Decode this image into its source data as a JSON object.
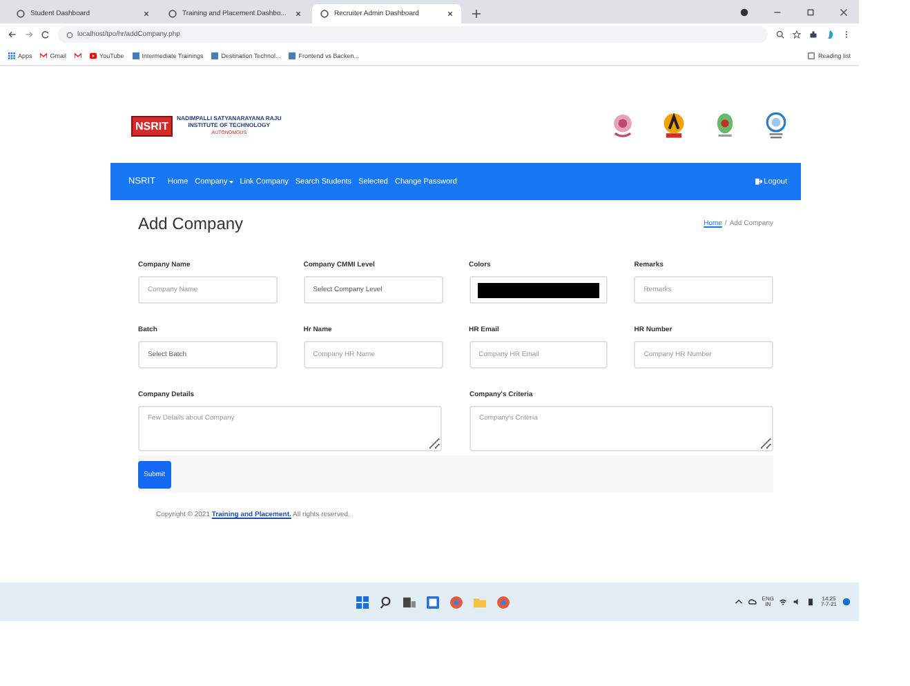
{
  "browser": {
    "tabs": [
      {
        "title": "Student Dashboard",
        "selected": false
      },
      {
        "title": "Training and Placement Dashbo...",
        "selected": false
      },
      {
        "title": "Recruiter Admin Dashboard",
        "selected": true
      }
    ],
    "url": "localhost/tpo/hr/addCompany.php",
    "bookmarks": [
      {
        "label": "Apps",
        "kind": "apps"
      },
      {
        "label": "Gmail",
        "kind": "mail"
      },
      {
        "kind": "mail"
      },
      {
        "label": "YouTube",
        "kind": "video"
      },
      {
        "label": "Intermediate Trainings",
        "kind": "page"
      },
      {
        "label": "Destination Technol...",
        "kind": "page"
      },
      {
        "label": "Frontend vs Backen...",
        "kind": "page"
      }
    ],
    "reading_list": "Reading list"
  },
  "header": {
    "logo_abbr": "NSRIT",
    "college_name": [
      "NADIMPALLI SATYANARAYANA RAJU",
      "INSTITUTE OF TECHNOLOGY"
    ],
    "college_status": "AUTONOMOUS"
  },
  "nav": {
    "brand": "NSRIT",
    "items": [
      {
        "label": "Home",
        "dropdown": false
      },
      {
        "label": "Company",
        "dropdown": true
      },
      {
        "label": "Link Company",
        "dropdown": false
      },
      {
        "label": "Search Students",
        "dropdown": false
      },
      {
        "label": "Selected",
        "dropdown": false
      },
      {
        "label": "Change Password",
        "dropdown": false
      }
    ],
    "logout": "Logout"
  },
  "page": {
    "title": "Add Company",
    "breadcrumb_separator": "/",
    "breadcrumb": [
      {
        "label": "Home",
        "link": true
      },
      {
        "label": "Add Company",
        "link": false
      }
    ]
  },
  "form": {
    "fields": [
      {
        "label": "Company Name",
        "kind": "input",
        "placeholder": "Company Name"
      },
      {
        "label": "Company CMMI Level",
        "kind": "select",
        "value": "Select Company Level"
      },
      {
        "label": "Colors",
        "kind": "color",
        "color": "#000000"
      },
      {
        "label": "Remarks",
        "kind": "input",
        "placeholder": "Remarks"
      },
      {
        "label": "Batch",
        "kind": "select",
        "value": "Select Batch"
      },
      {
        "label": "Hr Name",
        "kind": "input",
        "placeholder": "Company HR Name"
      },
      {
        "label": "HR Email",
        "kind": "input",
        "placeholder": "Company HR Email"
      },
      {
        "label": "HR Number",
        "kind": "input",
        "placeholder": "Company HR Number"
      },
      {
        "label": "Company Details",
        "kind": "textarea",
        "placeholder": "Few Details about Company"
      },
      {
        "label": "Company's Criteria",
        "kind": "textarea",
        "placeholder": "Company's Criteria"
      }
    ],
    "submit": "Submit"
  },
  "footer": {
    "prefix": "Copyright © 2021",
    "link": "Training and Placement.",
    "suffix": "All rights reserved."
  },
  "taskbar": {
    "language": "ENG",
    "region": "IN",
    "time": "14:25",
    "date": "7-7-21"
  }
}
